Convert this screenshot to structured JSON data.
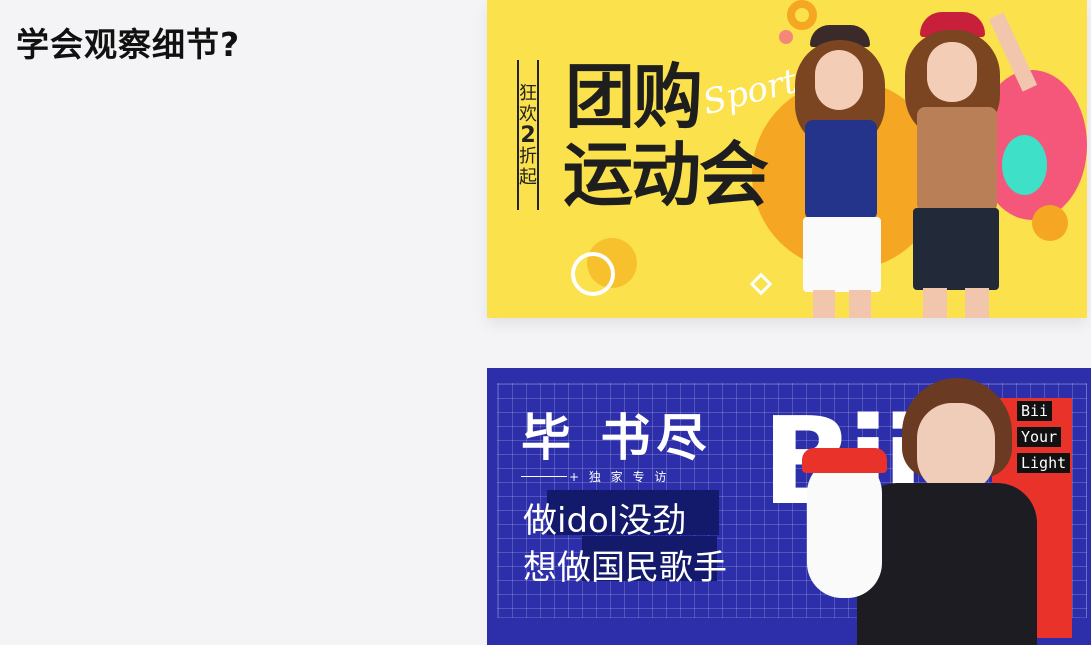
{
  "slide": {
    "title": "学会观察细节?"
  },
  "banner1": {
    "vertical_text": [
      "狂",
      "欢",
      "2",
      "折",
      "起"
    ],
    "headline_line1": "团购",
    "headline_line2": "运动会",
    "script_word": "Sports",
    "colors": {
      "background": "#fbe14b",
      "accent": "#f5a623",
      "pink": "#f4577a"
    }
  },
  "banner2": {
    "name": "毕 书尽",
    "subtitle": "+ 独 家 专 访",
    "line1": "做idol没劲",
    "line2": "想做国民歌手",
    "tags": [
      "Bii",
      "Your",
      "Light"
    ],
    "big_letters": "Bii",
    "colors": {
      "background": "#2c2fa9",
      "accent": "#e8322a"
    }
  }
}
